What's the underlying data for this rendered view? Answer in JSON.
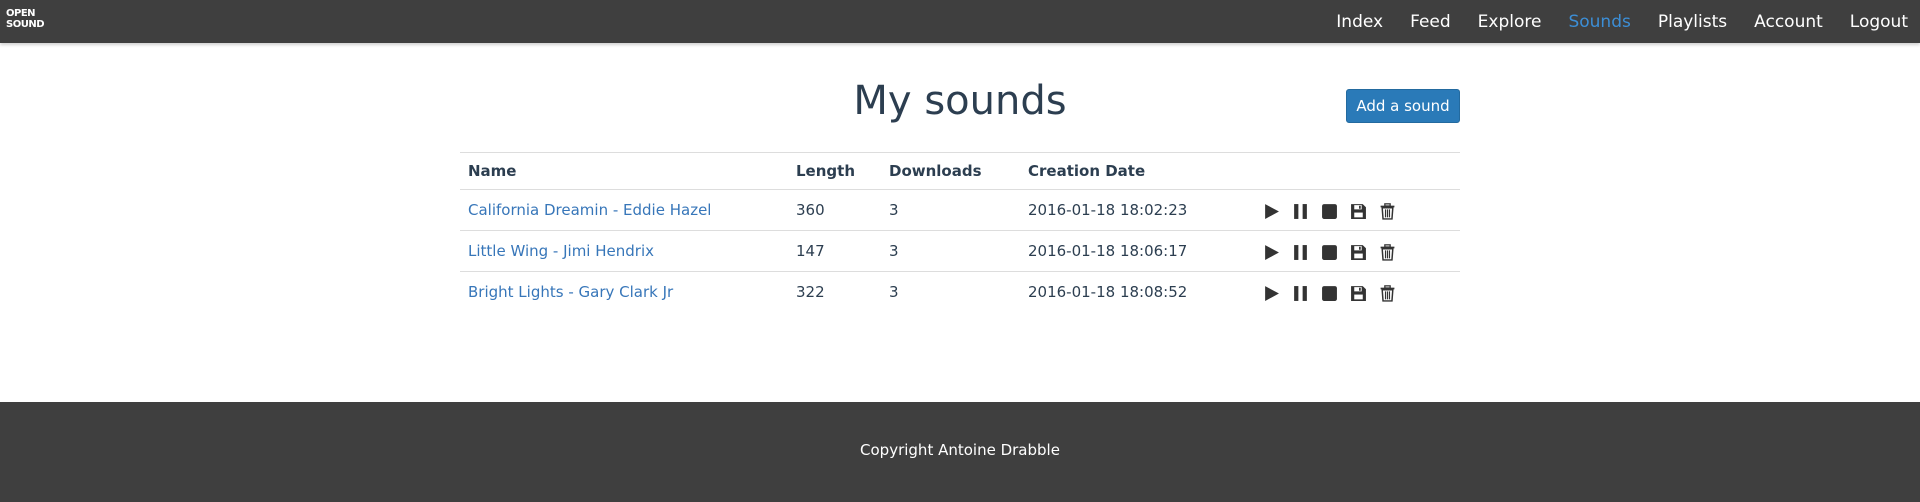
{
  "brand": {
    "line1": "OPEN",
    "line2": "SOUND"
  },
  "nav": {
    "items": [
      {
        "label": "Index"
      },
      {
        "label": "Feed"
      },
      {
        "label": "Explore"
      },
      {
        "label": "Sounds",
        "active": true
      },
      {
        "label": "Playlists"
      },
      {
        "label": "Account"
      },
      {
        "label": "Logout"
      }
    ]
  },
  "page": {
    "title": "My sounds",
    "add_button": "Add a sound"
  },
  "table": {
    "headers": [
      "Name",
      "Length",
      "Downloads",
      "Creation Date",
      ""
    ],
    "rows": [
      {
        "name": "California Dreamin - Eddie Hazel",
        "length": "360",
        "downloads": "3",
        "date": "2016-01-18 18:02:23"
      },
      {
        "name": "Little Wing - Jimi Hendrix",
        "length": "147",
        "downloads": "3",
        "date": "2016-01-18 18:06:17"
      },
      {
        "name": "Bright Lights - Gary Clark Jr",
        "length": "322",
        "downloads": "3",
        "date": "2016-01-18 18:08:52"
      }
    ],
    "action_icons": [
      "play-icon",
      "pause-icon",
      "stop-icon",
      "save-icon",
      "trash-icon"
    ]
  },
  "footer": {
    "copyright": "Copyright Antoine Drabble"
  },
  "colors": {
    "navbar": "#3f3f3f",
    "active_link": "#3c8ed6",
    "link": "#3776b9",
    "button": "#2a7ab8",
    "text": "#2c3e50"
  }
}
